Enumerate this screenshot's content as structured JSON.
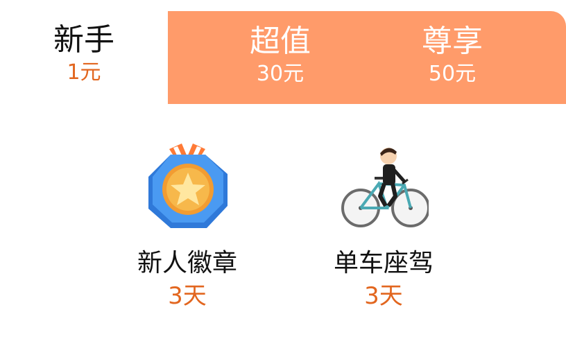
{
  "tabs": [
    {
      "name": "新手",
      "price": "1元"
    },
    {
      "name": "超值",
      "price": "30元"
    },
    {
      "name": "尊享",
      "price": "50元"
    }
  ],
  "benefits": [
    {
      "label": "新人徽章",
      "duration": "3天",
      "icon": "medal-icon"
    },
    {
      "label": "单车座驾",
      "duration": "3天",
      "icon": "bicycle-rider-icon"
    }
  ],
  "colors": {
    "accent_orange": "#ff9b6a",
    "price_orange": "#e2661f",
    "medal_blue": "#3d8ff0",
    "medal_gold": "#f7b84b"
  }
}
